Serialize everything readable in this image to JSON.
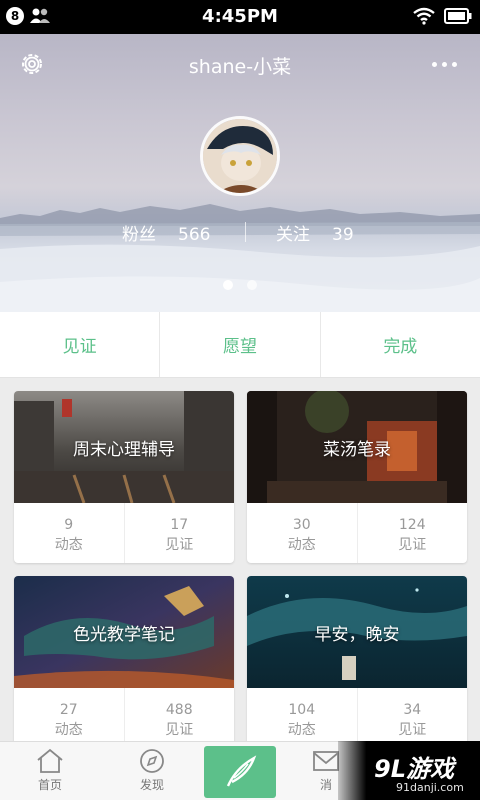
{
  "status": {
    "notif_count": "8",
    "time": "4:45PM"
  },
  "header": {
    "title": "shane-小菜"
  },
  "profile": {
    "fans_label": "粉丝",
    "fans_count": "566",
    "follow_label": "关注",
    "follow_count": "39",
    "page_index": 1,
    "page_total": 2
  },
  "tabs": [
    {
      "label": "见证"
    },
    {
      "label": "愿望"
    },
    {
      "label": "完成"
    }
  ],
  "cards": [
    {
      "title": "周末心理辅导",
      "posts": "9",
      "posts_label": "动态",
      "witness": "17",
      "witness_label": "见证"
    },
    {
      "title": "菜汤笔录",
      "posts": "30",
      "posts_label": "动态",
      "witness": "124",
      "witness_label": "见证"
    },
    {
      "title": "色光教学笔记",
      "posts": "27",
      "posts_label": "动态",
      "witness": "488",
      "witness_label": "见证"
    },
    {
      "title": "早安，晚安",
      "posts": "104",
      "posts_label": "动态",
      "witness": "34",
      "witness_label": "见证"
    }
  ],
  "bottom_nav": {
    "home": "首页",
    "discover": "发现",
    "messages": "消"
  },
  "watermark": {
    "main": "9L游戏",
    "sub": "91danji.com"
  },
  "colors": {
    "accent": "#5cc08a",
    "statusbar": "#000000"
  }
}
